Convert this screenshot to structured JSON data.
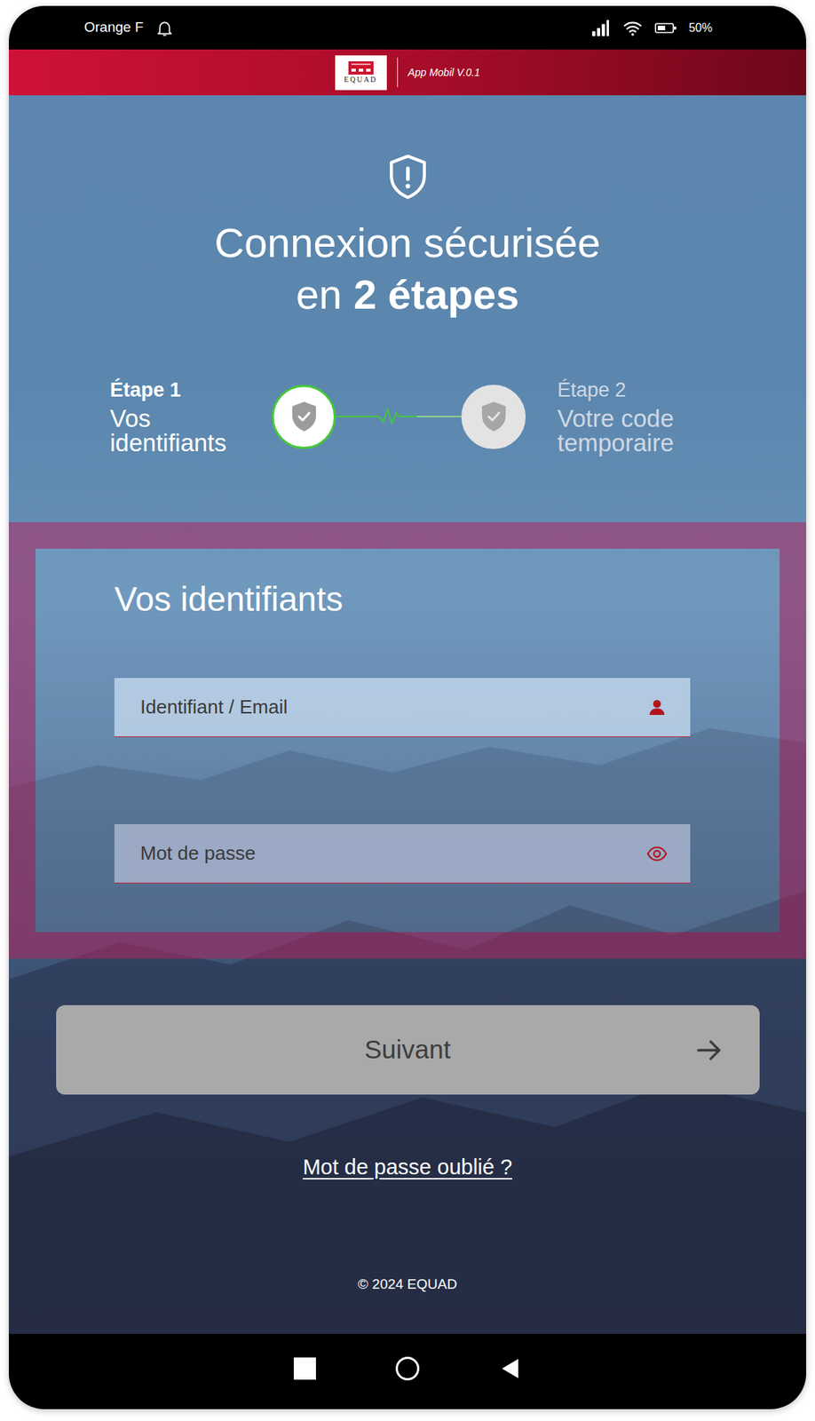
{
  "status_bar": {
    "carrier": "Orange F",
    "battery": "50%"
  },
  "header": {
    "logo": "EQUAD",
    "version": "App Mobil V.0.1"
  },
  "title": {
    "line1": "Connexion sécurisée",
    "line2": "en",
    "line2_emphasis": "2 étapes"
  },
  "steps": [
    {
      "label": "Étape 1",
      "text": "Vos identifiants",
      "selected": true
    },
    {
      "label": "Étape 2",
      "text": "Votre code temporaire",
      "selected": false
    }
  ],
  "form": {
    "title": "Vos identifiants",
    "fields": [
      {
        "placeholder": "Identifiant / Email",
        "kind": "text"
      },
      {
        "placeholder": "Mot de passe",
        "kind": "password"
      }
    ]
  },
  "button": {
    "label": "Suivant",
    "disabled": true
  },
  "forgot_link": "Mot de passe oublié ?",
  "footer": "© 2024 EQUAD"
}
